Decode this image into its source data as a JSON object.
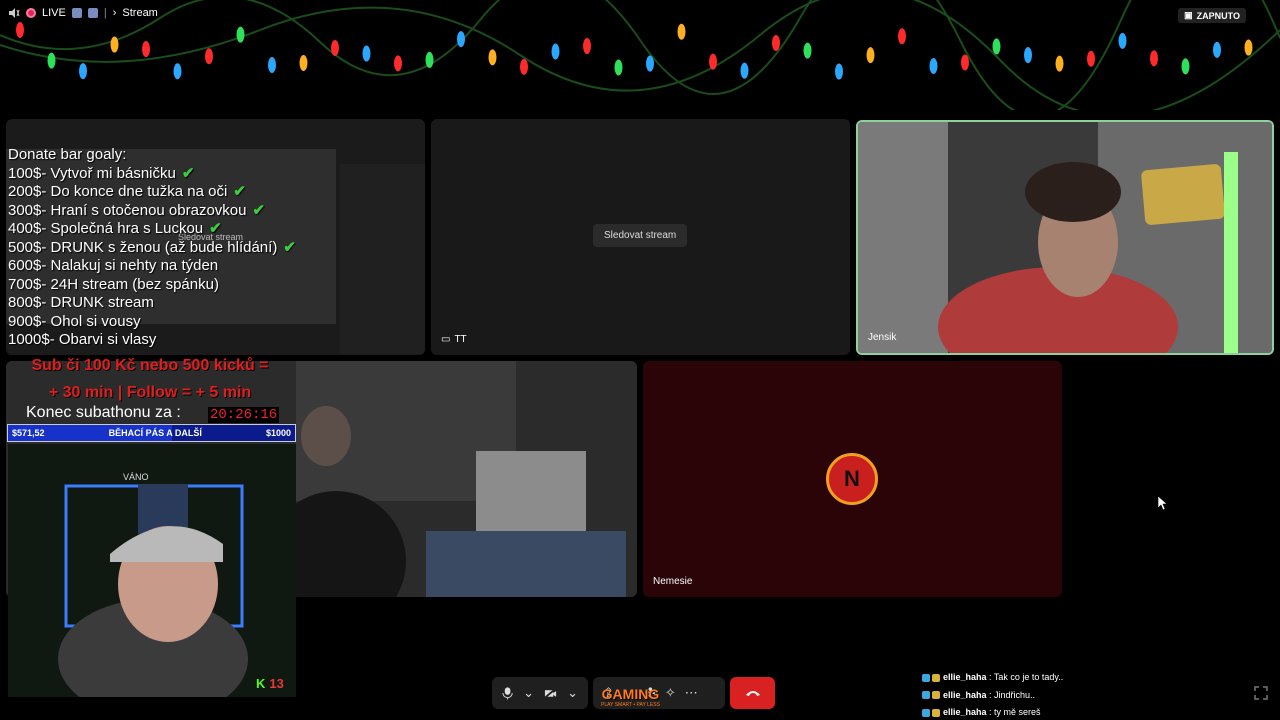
{
  "topbar": {
    "live_label": "LIVE",
    "stream_label": "Stream",
    "toggle_label": "ZAPNUTO"
  },
  "tiles": {
    "tile1": {
      "label": "",
      "inner_text": "Sledovat stream"
    },
    "tile2": {
      "watch_button": "Sledovat stream",
      "label": "TT"
    },
    "tile3": {
      "label": "Jensik"
    },
    "tile5": {
      "label": "Nemesie",
      "avatar_letter": "N"
    }
  },
  "donate_bar": {
    "title": "Donate bar goaly:",
    "goals": [
      {
        "text": "100$- Vytvoř mi básničku",
        "done": true
      },
      {
        "text": "200$- Do konce dne tužka na oči",
        "done": true
      },
      {
        "text": "300$- Hraní s otočenou obrazovkou",
        "done": true
      },
      {
        "text": "400$- Společná hra s Luckou",
        "done": true
      },
      {
        "text": "500$- DRUNK s ženou (až bude hlídání)",
        "done": true
      },
      {
        "text": "600$- Nalakuj si nehty na týden",
        "done": false
      },
      {
        "text": "700$- 24H stream (bez spánku)",
        "done": false
      },
      {
        "text": "800$-  DRUNK stream",
        "done": false
      },
      {
        "text": "900$- Ohol si vousy",
        "done": false
      },
      {
        "text": "1000$- Obarvi si vlasy",
        "done": false
      }
    ]
  },
  "subathon": {
    "line1": "Sub či 100 Kč nebo 500 kicků =",
    "line2": "+ 30 min | Follow = + 5 min",
    "end_label": "Konec subathonu za :",
    "timer": "20:26:16",
    "goal_current": "$571,52",
    "goal_name": "BĚHACÍ PÁS A DALŠÍ",
    "goal_target": "$1000",
    "goal_progress": 0.5715
  },
  "webcam": {
    "banner": "VÁNO",
    "kick_count": "13",
    "kick_letter": "K"
  },
  "controls": {
    "brand_top": "GAMING",
    "brand_bottom": "PLAY SMART • PAY LESS"
  },
  "chat": [
    {
      "user": "ellie_haha",
      "message": "Tak co je to tady.."
    },
    {
      "user": "ellie_haha",
      "message": "Jindřichu.."
    },
    {
      "user": "ellie_haha",
      "message": "ty mě sereš"
    }
  ],
  "colors": {
    "hangup": "#d92121",
    "active_speaker_border": "#8fd19e",
    "check": "#39d03b",
    "subathon_red": "#e11d1d"
  }
}
